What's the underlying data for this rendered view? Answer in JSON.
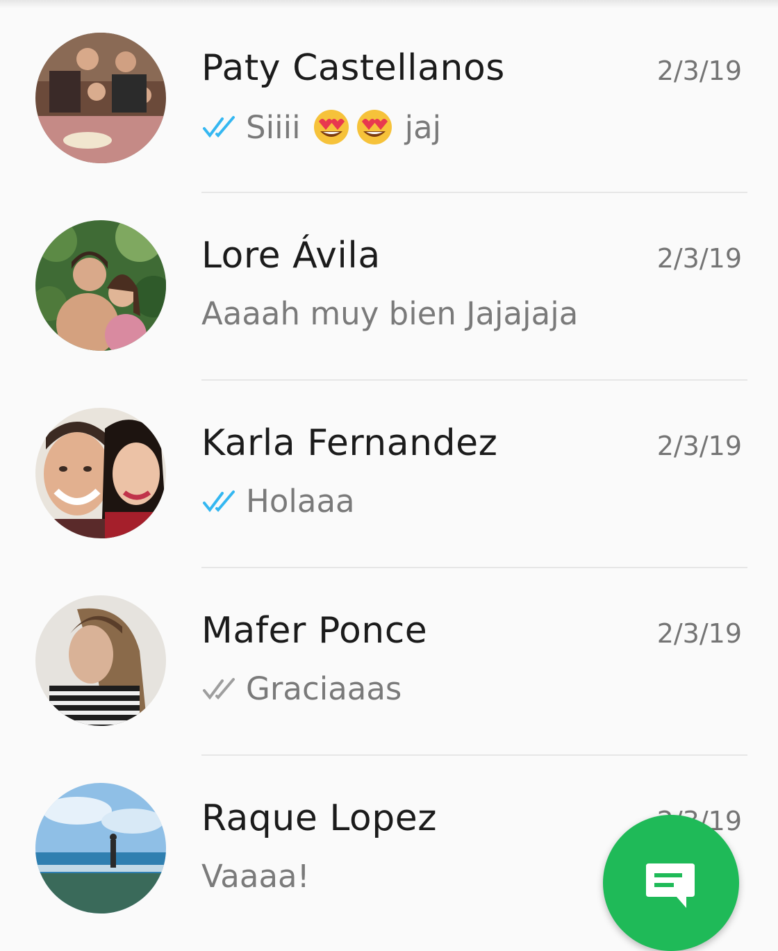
{
  "chats": [
    {
      "name": "Paty Castellanos",
      "time": "2/3/19",
      "preview": "Siiii",
      "preview_suffix": "jaj",
      "status": "read",
      "emoji": [
        "heart-eyes-emoji",
        "heart-eyes-emoji"
      ]
    },
    {
      "name": "Lore Ávila",
      "time": "2/3/19",
      "preview": "Aaaah muy bien Jajajaja",
      "status": "none"
    },
    {
      "name": "Karla Fernandez",
      "time": "2/3/19",
      "preview": "Holaaa",
      "status": "read"
    },
    {
      "name": "Mafer Ponce",
      "time": "2/3/19",
      "preview": "Graciaaas",
      "status": "delivered"
    },
    {
      "name": "Raque Lopez",
      "time": "2/3/19",
      "preview": "Vaaaa!",
      "status": "none"
    }
  ],
  "colors": {
    "read_tick": "#34b7f1",
    "delivered_tick": "#9e9e9e",
    "fab": "#1fba58"
  },
  "fab": {
    "icon": "new-message-icon"
  }
}
